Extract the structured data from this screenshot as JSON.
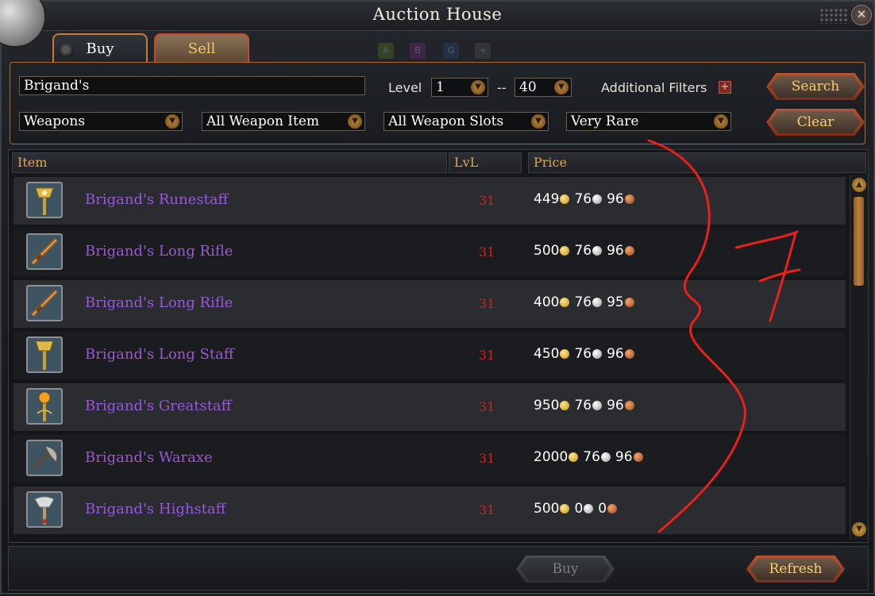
{
  "window": {
    "title": "Auction House"
  },
  "tabs": [
    {
      "label": "Buy",
      "active": true
    },
    {
      "label": "Sell",
      "active": false
    }
  ],
  "ghost_boxes": [
    "A",
    "B",
    "G"
  ],
  "filters": {
    "search_value": "Brigand's",
    "level_label": "Level",
    "level_min": "1",
    "level_sep": "--",
    "level_max": "40",
    "additional_filters_label": "Additional Filters",
    "category": "Weapons",
    "item_type": "All Weapon Item",
    "slots": "All Weapon Slots",
    "rarity": "Very Rare"
  },
  "buttons": {
    "search": "Search",
    "clear": "Clear",
    "buy": "Buy",
    "refresh": "Refresh"
  },
  "columns": {
    "item": "Item",
    "level": "LvL",
    "price": "Price"
  },
  "rows": [
    {
      "name": "Brigand's Runestaff",
      "level": "31",
      "gold": "449",
      "silver": "76",
      "copper": "96",
      "icon": "runestaff-icon"
    },
    {
      "name": "Brigand's Long Rifle",
      "level": "31",
      "gold": "500",
      "silver": "76",
      "copper": "96",
      "icon": "rifle-icon"
    },
    {
      "name": "Brigand's Long Rifle",
      "level": "31",
      "gold": "400",
      "silver": "76",
      "copper": "95",
      "icon": "rifle-icon"
    },
    {
      "name": "Brigand's Long Staff",
      "level": "31",
      "gold": "450",
      "silver": "76",
      "copper": "96",
      "icon": "staff-icon"
    },
    {
      "name": "Brigand's Greatstaff",
      "level": "31",
      "gold": "950",
      "silver": "76",
      "copper": "96",
      "icon": "greatstaff-icon"
    },
    {
      "name": "Brigand's Waraxe",
      "level": "31",
      "gold": "2000",
      "silver": "76",
      "copper": "96",
      "icon": "waraxe-icon"
    },
    {
      "name": "Brigand's Highstaff",
      "level": "31",
      "gold": "500",
      "silver": "0",
      "copper": "0",
      "icon": "highstaff-icon"
    }
  ],
  "annotation": {
    "text": "7",
    "color": "#e8211c"
  },
  "colors": {
    "accent": "#c77b3a",
    "item_name": "#9a57d8",
    "level": "#d2231b",
    "header": "#e3a44e",
    "button_text": "#f7cf6b"
  }
}
